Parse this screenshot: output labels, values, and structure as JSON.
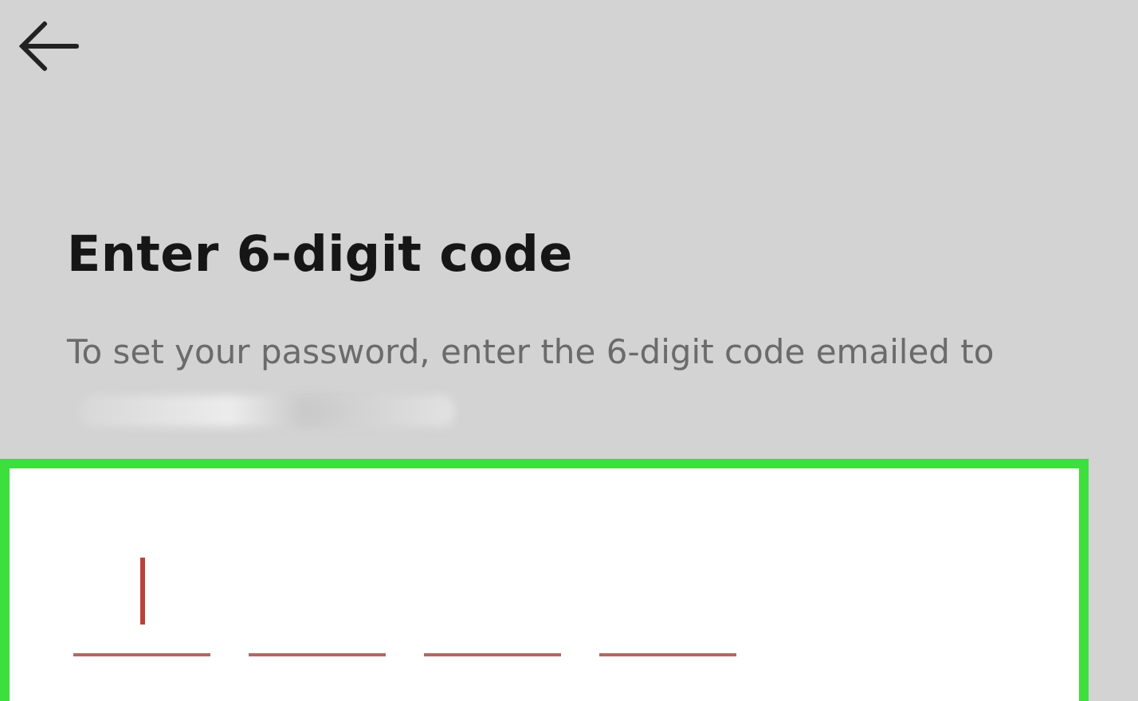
{
  "title": "Enter 6-digit code",
  "instructions": "To set your password, enter the 6-digit code emailed to",
  "code_slots": [
    {
      "active": true
    },
    {
      "active": false
    },
    {
      "active": false
    },
    {
      "active": false
    }
  ]
}
